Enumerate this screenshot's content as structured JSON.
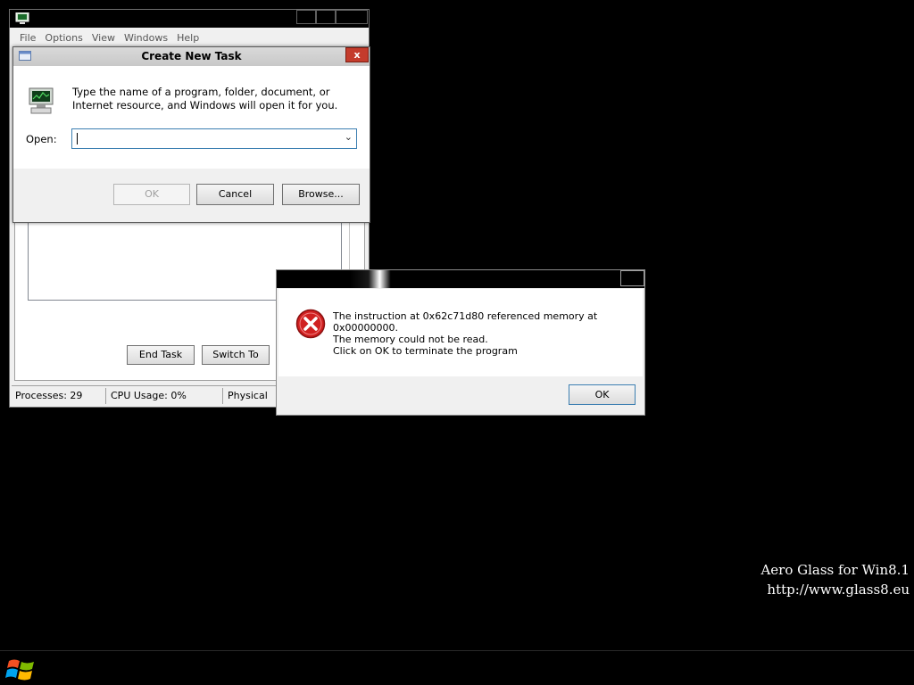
{
  "task_manager": {
    "menu": [
      "File",
      "Options",
      "View",
      "Windows",
      "Help"
    ],
    "buttons": {
      "end_task": "End Task",
      "switch_to": "Switch To"
    },
    "status": {
      "processes": "Processes: 29",
      "cpu": "CPU Usage: 0%",
      "memory": "Physical Me"
    }
  },
  "run_dialog": {
    "title": "Create New Task",
    "close": "x",
    "message": "Type the name of a program, folder, document, or Internet resource, and Windows will open it for you.",
    "open_label": "Open:",
    "open_value": "",
    "buttons": {
      "ok": "OK",
      "cancel": "Cancel",
      "browse": "Browse..."
    }
  },
  "error_dialog": {
    "line1": "The instruction at 0x62c71d80 referenced memory at 0x00000000.",
    "line2": "The memory could not be read.",
    "line3": "Click on OK to terminate the program",
    "ok": "OK"
  },
  "desktop": {
    "watermark_line1": "Aero Glass for Win8.1",
    "watermark_line2": "http://www.glass8.eu"
  },
  "icons": [
    "task-manager-icon",
    "computer-icon",
    "error-icon",
    "windows-start-icon"
  ],
  "colors": {
    "close_button": "#c43c2c",
    "error_red": "#d02020",
    "input_border": "#3c7fb1"
  }
}
